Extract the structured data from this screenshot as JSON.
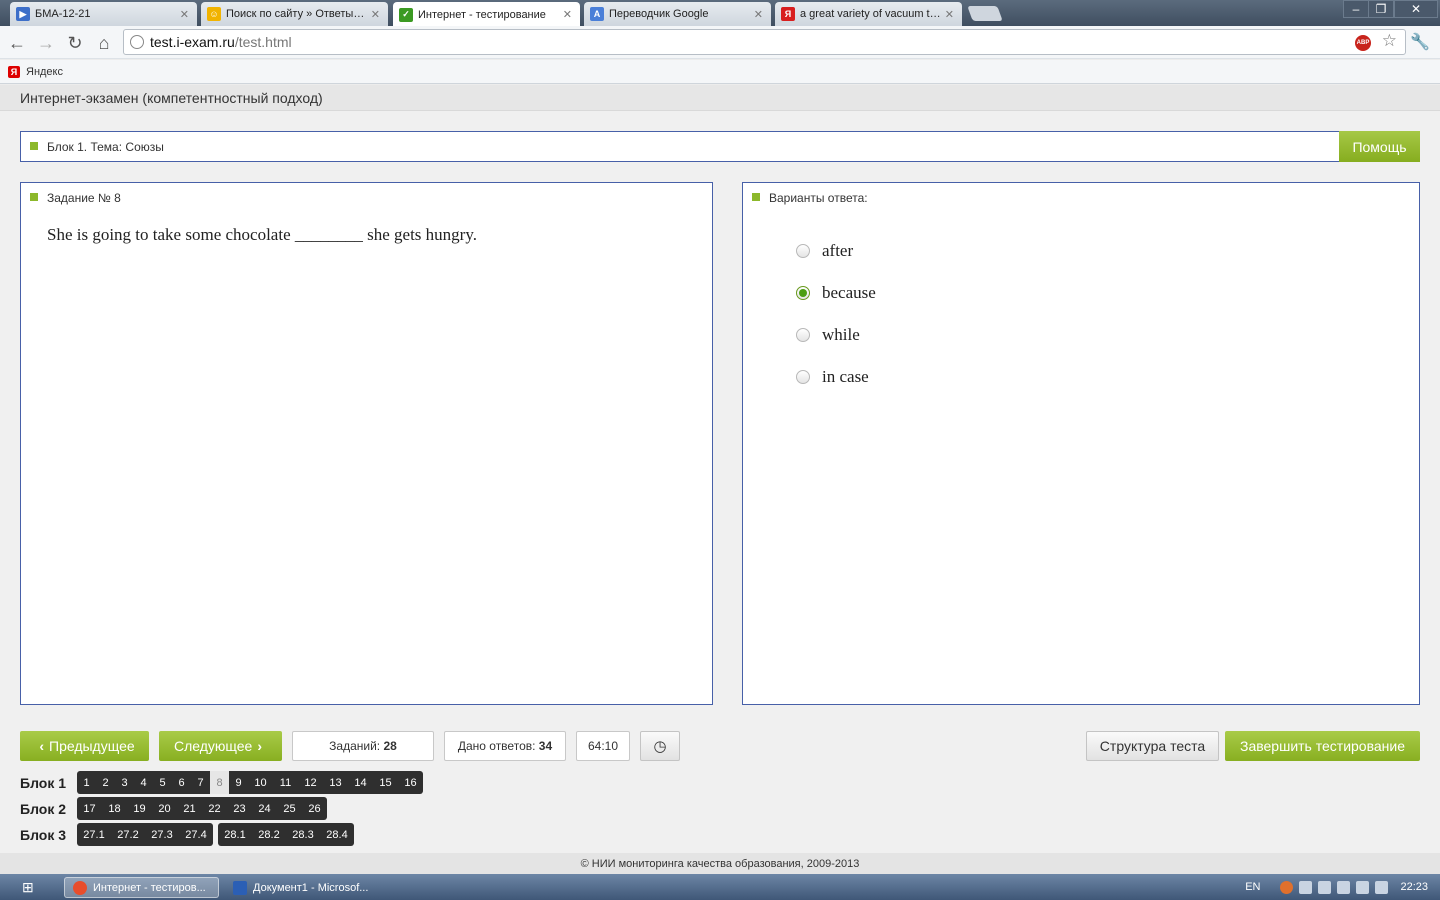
{
  "browser": {
    "tabs": [
      {
        "title": "БМА-12-21",
        "active": false,
        "icon_color": "#3d6fc9"
      },
      {
        "title": "Поиск по сайту » Ответы i-e",
        "active": false,
        "icon_color": "#f1b300"
      },
      {
        "title": "Интернет - тестирование",
        "active": true,
        "icon_color": "#3b9a22"
      },
      {
        "title": "Переводчик Google",
        "active": false,
        "icon_color": "#4a7fd8"
      },
      {
        "title": "a great variety of vacuum tec",
        "active": false,
        "icon_color": "#d81e1e"
      }
    ],
    "url_host": "test.i-exam.ru",
    "url_path": "/test.html",
    "abp_label": "ABP",
    "bookmarks": [
      {
        "label": "Яндекс",
        "icon": "Я"
      }
    ]
  },
  "page": {
    "header_title": "Интернет-экзамен (компетентностный подход)",
    "block_title": "Блок 1. Тема: Союзы",
    "help_label": "Помощь",
    "task_title": "Задание № 8",
    "question": "She is going to take some chocolate ________ she gets hungry.",
    "answers_title": "Варианты ответа:",
    "options": [
      {
        "label": "after",
        "selected": false
      },
      {
        "label": "because",
        "selected": true
      },
      {
        "label": "while",
        "selected": false
      },
      {
        "label": "in case",
        "selected": false
      }
    ],
    "prev_label": "Предыдущее",
    "next_label": "Следующее",
    "tasks_label": "Заданий:",
    "tasks_count": "28",
    "answered_label": "Дано ответов:",
    "answered_count": "34",
    "timer": "64:10",
    "clock_icon": "clock-icon",
    "structure_label": "Структура теста",
    "finish_label": "Завершить тестирование",
    "blocks": [
      {
        "label": "Блок 1",
        "groups": [
          [
            "1",
            "2",
            "3",
            "4",
            "5",
            "6",
            "7",
            "8",
            "9",
            "10",
            "11",
            "12",
            "13",
            "14",
            "15",
            "16"
          ]
        ],
        "current": "8"
      },
      {
        "label": "Блок 2",
        "groups": [
          [
            "17",
            "18",
            "19",
            "20",
            "21",
            "22",
            "23",
            "24",
            "25",
            "26"
          ]
        ],
        "current": ""
      },
      {
        "label": "Блок 3",
        "groups": [
          [
            "27.1",
            "27.2",
            "27.3",
            "27.4"
          ],
          [
            "28.1",
            "28.2",
            "28.3",
            "28.4"
          ]
        ],
        "current": ""
      }
    ],
    "footer": "© НИИ мониторинга качества образования, 2009-2013"
  },
  "taskbar": {
    "items": [
      {
        "label": "Интернет - тестиров...",
        "active": true,
        "icon_color": "#e84d2c"
      },
      {
        "label": "Документ1 - Microsof...",
        "active": false,
        "icon_color": "#2b5fb5"
      }
    ],
    "lang": "EN",
    "time": "22:23"
  },
  "colors": {
    "accent_green": "#8cb82b",
    "panel_border": "#4760a8",
    "selected_radio": "#4b9e12"
  }
}
